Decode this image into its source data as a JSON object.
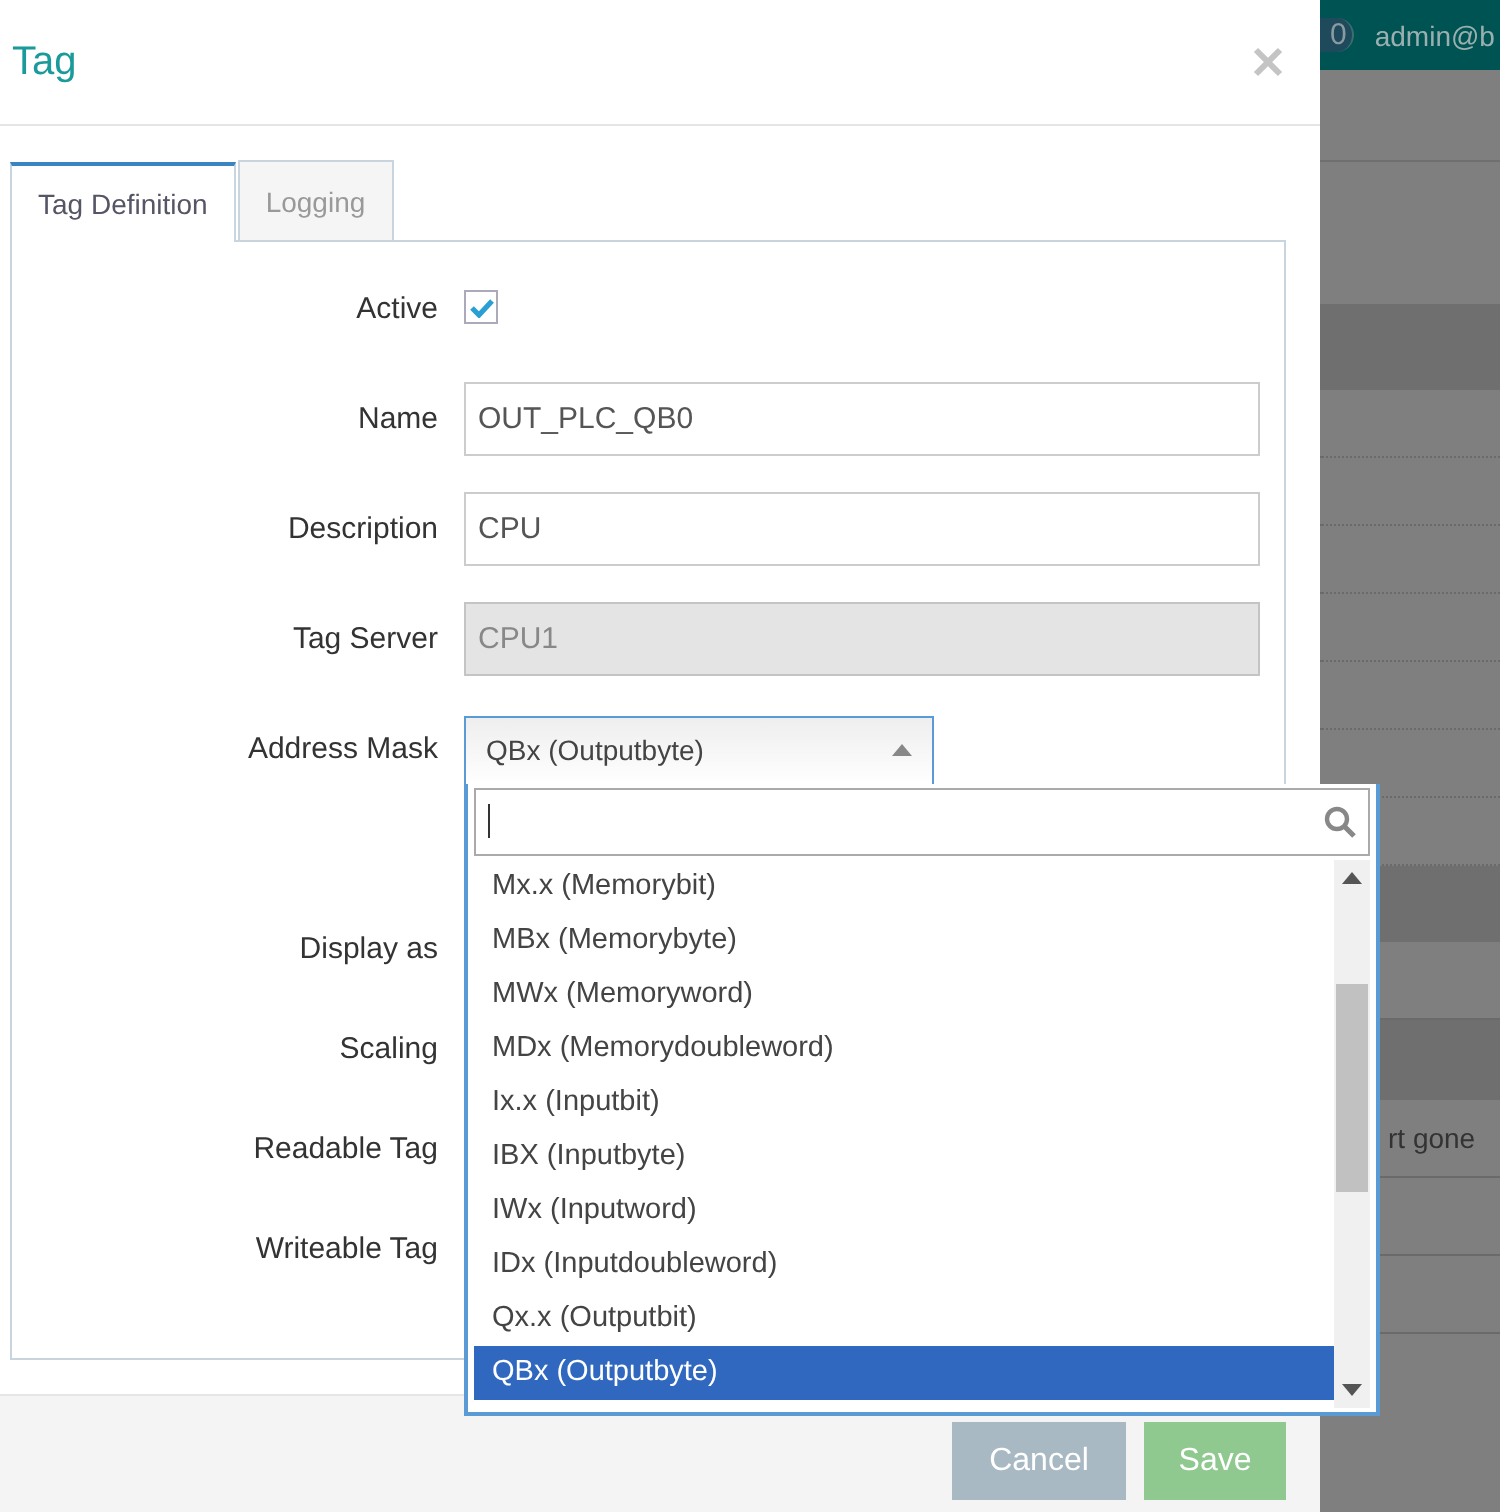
{
  "background": {
    "badge": "0",
    "user": "admin@b",
    "cell_text": "rt gone"
  },
  "dialog": {
    "title": "Tag",
    "tabs": [
      {
        "label": "Tag Definition",
        "selected": true
      },
      {
        "label": "Logging",
        "selected": false
      }
    ],
    "fields": [
      {
        "kind": "checkbox",
        "label": "Active",
        "checked": true
      },
      {
        "kind": "text",
        "label": "Name",
        "value": "OUT_PLC_QB0",
        "disabled": false
      },
      {
        "kind": "text",
        "label": "Description",
        "value": "CPU",
        "disabled": false
      },
      {
        "kind": "text",
        "label": "Tag Server",
        "value": "CPU1",
        "disabled": true
      },
      {
        "kind": "select",
        "label": "Address Mask",
        "value": "QBx (Outputbyte)",
        "expanded": true
      },
      {
        "kind": "label",
        "label": "Display as"
      },
      {
        "kind": "label",
        "label": "Scaling"
      },
      {
        "kind": "label",
        "label": "Readable Tag"
      },
      {
        "kind": "label",
        "label": "Writeable Tag"
      }
    ],
    "dropdown": {
      "options": [
        {
          "label": "Mx.x (Memorybit)",
          "selected": false
        },
        {
          "label": "MBx (Memorybyte)",
          "selected": false
        },
        {
          "label": "MWx (Memoryword)",
          "selected": false
        },
        {
          "label": "MDx (Memorydoubleword)",
          "selected": false
        },
        {
          "label": "Ix.x (Inputbit)",
          "selected": false
        },
        {
          "label": "IBX (Inputbyte)",
          "selected": false
        },
        {
          "label": "IWx (Inputword)",
          "selected": false
        },
        {
          "label": "IDx (Inputdoubleword)",
          "selected": false
        },
        {
          "label": "Qx.x (Outputbit)",
          "selected": false
        },
        {
          "label": "QBx (Outputbyte)",
          "selected": true
        }
      ]
    },
    "buttons": [
      {
        "label": "Cancel",
        "kind": "secondary"
      },
      {
        "label": "Save",
        "kind": "primary"
      }
    ]
  }
}
